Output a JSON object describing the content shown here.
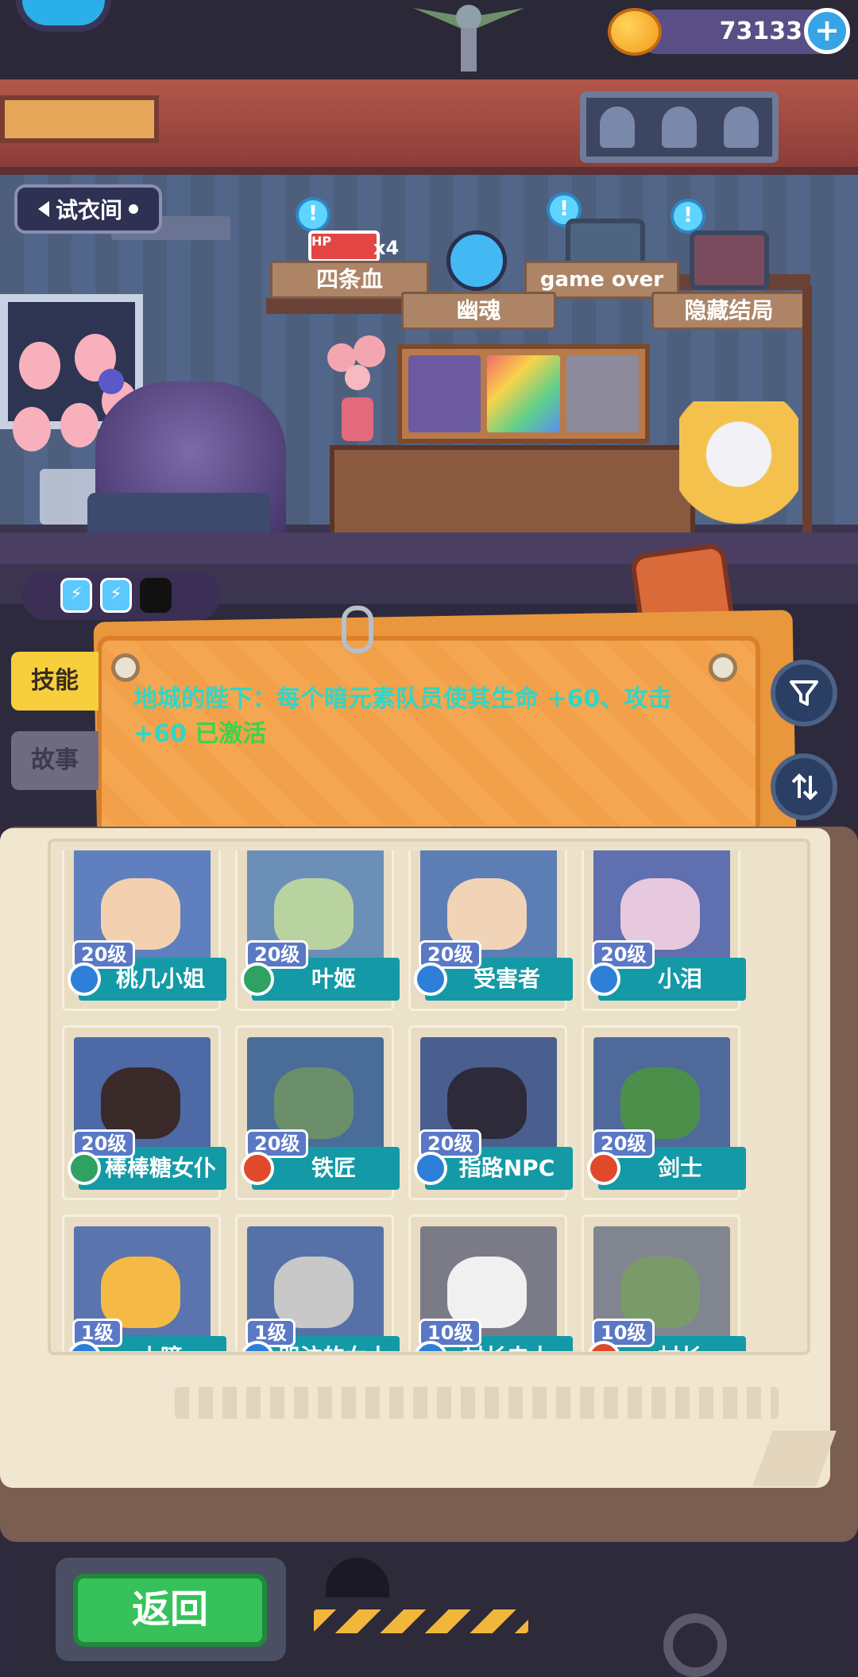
{
  "currency": {
    "amount": "73133",
    "add_icon": "plus-icon"
  },
  "fitting_room": {
    "label": "试衣间"
  },
  "achievements": [
    {
      "label": "四条血",
      "icon": "hp-icon",
      "icon_text": "HP",
      "multiplier": "x4"
    },
    {
      "label": "幽魂",
      "icon": "ghost-skull-icon"
    },
    {
      "label": "game over",
      "icon": "tv-gravestone-icon"
    },
    {
      "label": "隐藏结局",
      "icon": "tv-portrait-icon"
    }
  ],
  "energy": {
    "filled": 2,
    "total": 3,
    "icon": "energy-icon"
  },
  "side_tabs": {
    "skill": "技能",
    "story": "故事"
  },
  "skill": {
    "text": "地城的陛下：每个暗元素队员使其生命 +60、攻击 +60 ",
    "status": "已激活"
  },
  "characters": [
    {
      "name": "桃几小姐",
      "level": "20级",
      "element": "blue"
    },
    {
      "name": "叶姬",
      "level": "20级",
      "element": "green"
    },
    {
      "name": "受害者",
      "level": "20级",
      "element": "blue"
    },
    {
      "name": "小泪",
      "level": "20级",
      "element": "blue"
    },
    {
      "name": "棒棒糖女仆",
      "level": "20级",
      "element": "green"
    },
    {
      "name": "铁匠",
      "level": "20级",
      "element": "red"
    },
    {
      "name": "指路NPC",
      "level": "20级",
      "element": "blue"
    },
    {
      "name": "剑士",
      "level": "20级",
      "element": "red"
    },
    {
      "name": "小瞳",
      "level": "1级",
      "element": "blue"
    },
    {
      "name": "哭泣的女人",
      "level": "1级",
      "element": "blue"
    },
    {
      "name": "村长夫人",
      "level": "10级",
      "element": "blue"
    },
    {
      "name": "村长",
      "level": "10级",
      "element": "red"
    }
  ],
  "back_button": {
    "label": "返回"
  },
  "colors": {
    "name_bar": "#139aa6",
    "skill_text": "#2fd6c7",
    "skill_active": "#3bd34d",
    "element_blue": "#2d7fd8",
    "element_green": "#2fa162",
    "element_red": "#e04a2a"
  }
}
